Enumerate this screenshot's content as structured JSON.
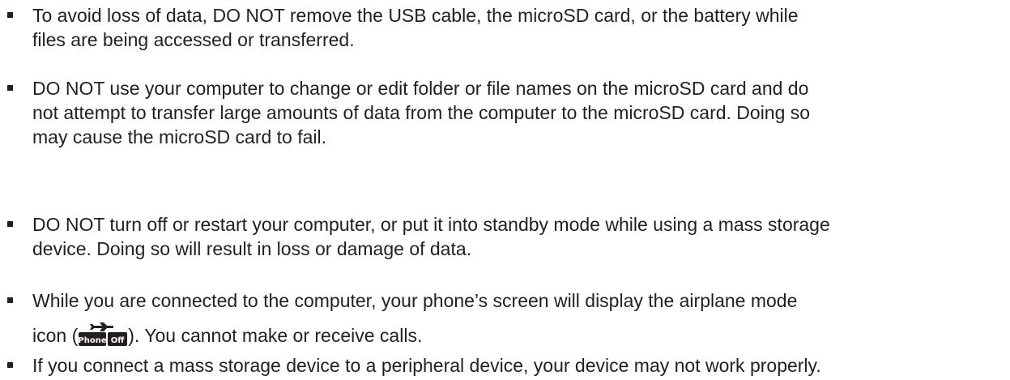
{
  "bullets": [
    {
      "lines": [
        "To avoid loss of data, DO NOT remove the USB cable, the microSD card, or the battery while",
        "files are being accessed or transferred."
      ]
    },
    {
      "lines": [
        "DO NOT use your computer to change or edit folder or file names on the microSD card and do",
        "not attempt to transfer large amounts of data from the computer to the microSD card. Doing so",
        "may cause the microSD card to fail."
      ]
    },
    {
      "lines": [
        "DO NOT turn off or restart your computer, or put it into standby mode while using a mass storage",
        "device. Doing so will result in loss or damage of data."
      ]
    },
    {
      "line1": "While you are connected to the computer, your phone’s screen will display the airplane mode",
      "line2_before": "icon (",
      "icon_name": "airplane-mode-icon",
      "icon_text_left": "Phone",
      "icon_text_right": "Off",
      "line2_after": "). You cannot make or receive calls."
    },
    {
      "lines": [
        "If you connect a mass storage device to a peripheral device, your device may not work properly."
      ]
    }
  ]
}
